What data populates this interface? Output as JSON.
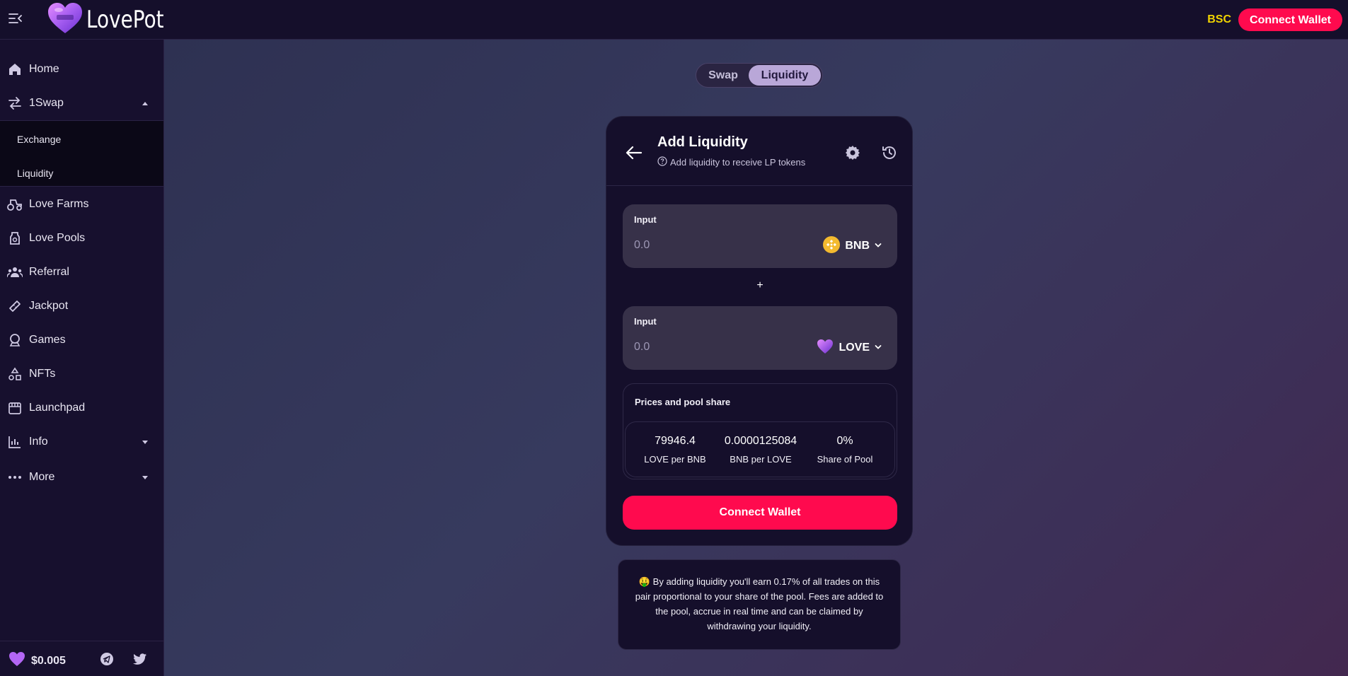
{
  "app": {
    "name": "LovePot",
    "network": "BSC",
    "connect_wallet": "Connect Wallet"
  },
  "sidebar": {
    "items": [
      {
        "label": "Home",
        "icon": "home-icon"
      },
      {
        "label": "1Swap",
        "icon": "swap-arrows-icon",
        "expanded": true
      },
      {
        "label": "Love Farms",
        "icon": "tractor-icon"
      },
      {
        "label": "Love Pools",
        "icon": "pool-jar-icon"
      },
      {
        "label": "Referral",
        "icon": "people-icon"
      },
      {
        "label": "Jackpot",
        "icon": "ticket-icon"
      },
      {
        "label": "Games",
        "icon": "crystal-ball-icon"
      },
      {
        "label": "NFTs",
        "icon": "shapes-icon"
      },
      {
        "label": "Launchpad",
        "icon": "storefront-icon"
      },
      {
        "label": "Info",
        "icon": "bar-chart-icon"
      },
      {
        "label": "More",
        "icon": "more-dots-icon"
      }
    ],
    "subitems": [
      {
        "label": "Exchange"
      },
      {
        "label": "Liquidity"
      }
    ],
    "footer": {
      "price": "$0.005"
    }
  },
  "tabs": [
    {
      "label": "Swap",
      "active": false
    },
    {
      "label": "Liquidity",
      "active": true
    }
  ],
  "card": {
    "title": "Add Liquidity",
    "subtitle": "Add liquidity to receive LP tokens",
    "inputs": [
      {
        "label": "Input",
        "placeholder": "0.0",
        "token": "BNB"
      },
      {
        "label": "Input",
        "placeholder": "0.0",
        "token": "LOVE"
      }
    ],
    "plus": "+",
    "prices": {
      "title": "Prices and pool share",
      "items": [
        {
          "value": "79946.4",
          "label": "LOVE per BNB"
        },
        {
          "value": "0.0000125084",
          "label": "BNB per LOVE"
        },
        {
          "value": "0%",
          "label": "Share of Pool"
        }
      ]
    },
    "connect_button": "Connect Wallet"
  },
  "note": "🤑 By adding liquidity you'll earn 0.17% of all trades on this pair proportional to your share of the pool. Fees are added to the pool, accrue in real time and can be claimed by withdrawing your liquidity.",
  "colors": {
    "accent": "#ff0a4e",
    "network": "#f0d300",
    "tab_active": "#b9a7d8",
    "card_bg": "#150f2b",
    "input_bg": "#373149"
  }
}
